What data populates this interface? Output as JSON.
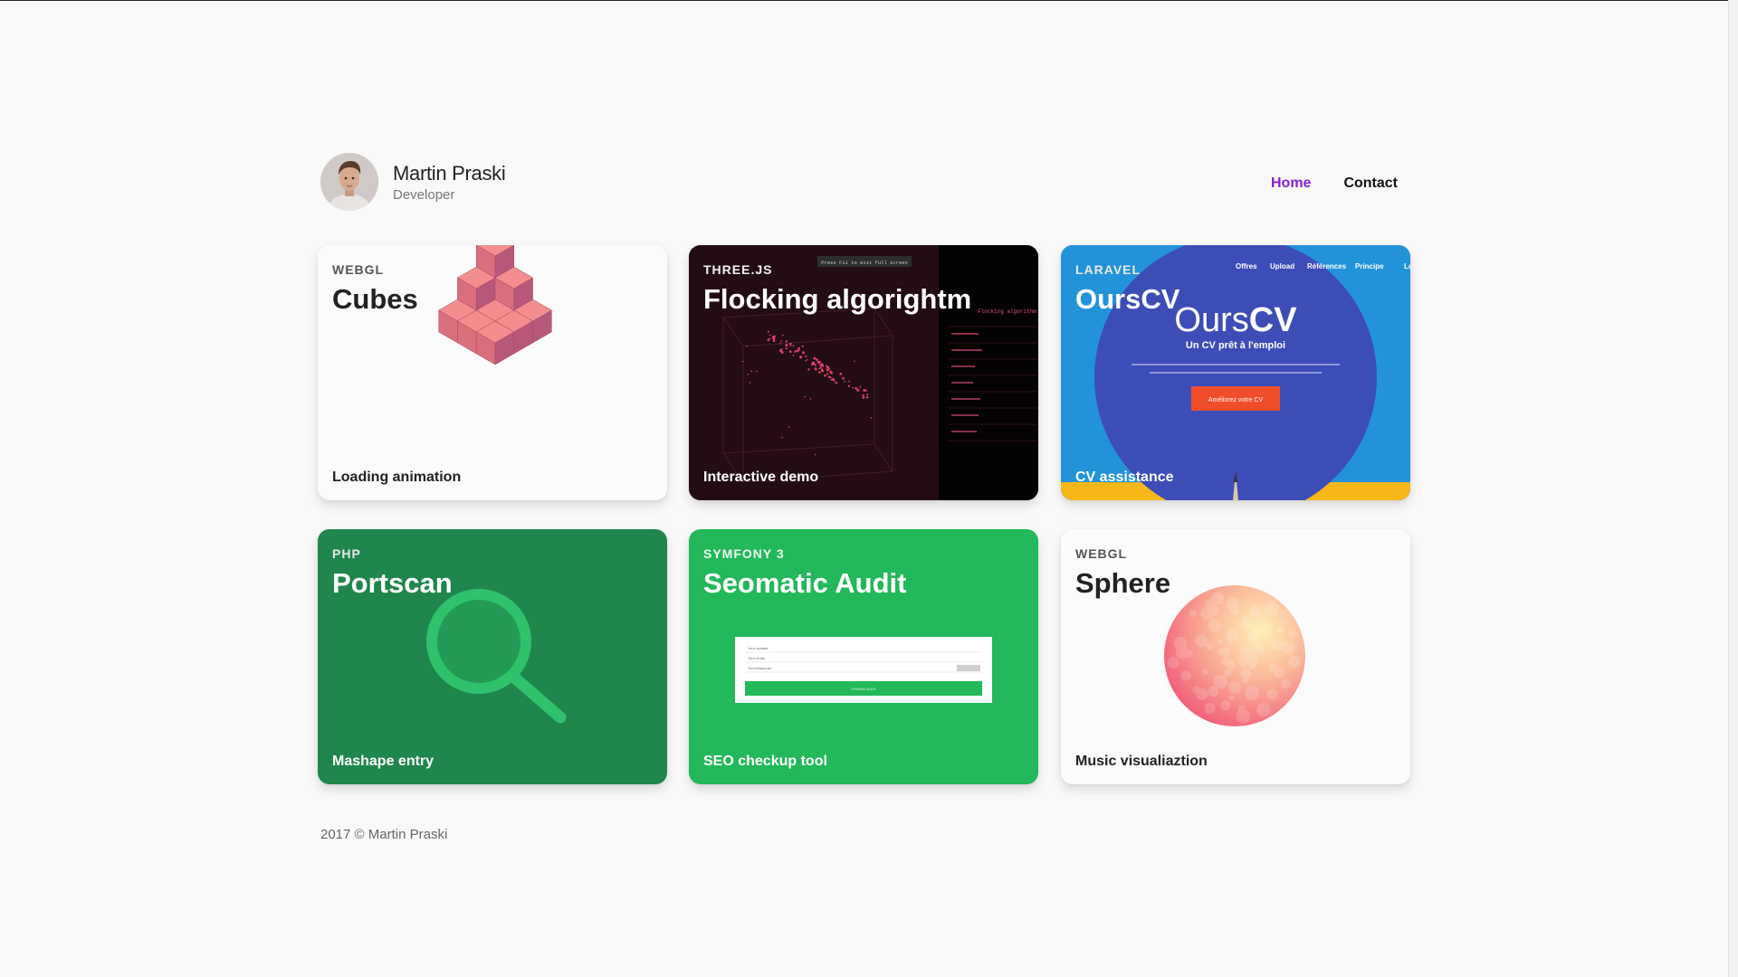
{
  "brand": {
    "name": "Martin Praski",
    "role": "Developer"
  },
  "nav": [
    {
      "label": "Home",
      "active": true
    },
    {
      "label": "Contact",
      "active": false
    }
  ],
  "projects": [
    {
      "tag": "WEBGL",
      "title": "Cubes",
      "description": "Loading animation",
      "icon": "cubes-3d-icon"
    },
    {
      "tag": "THREE.JS",
      "title": "Flocking algorightm",
      "description": "Interactive demo",
      "icon": "flocking-preview"
    },
    {
      "tag": "LARAVEL",
      "title": "OursCV",
      "description": "CV assistance",
      "icon": "ourscv-preview"
    },
    {
      "tag": "PHP",
      "title": "Portscan",
      "description": "Mashape entry",
      "icon": "magnifier-icon"
    },
    {
      "tag": "SYMFONY 3",
      "title": "Seomatic Audit",
      "description": "SEO checkup tool",
      "icon": "audit-form-preview"
    },
    {
      "tag": "WEBGL",
      "title": "Sphere",
      "description": "Music visualiaztion",
      "icon": "sphere-icon"
    }
  ],
  "previews": {
    "flocking": {
      "fullscreen_hint": "Press F11 to exit full screen",
      "panel_title": "Flocking algorithm"
    },
    "ourscv": {
      "nav": [
        "Offres",
        "Upload",
        "Références",
        "Principe",
        "Lo"
      ],
      "logo_light": "Ours",
      "logo_bold": "CV",
      "tagline": "Un CV prêt à l'emploi",
      "button": "Améliorez votre CV"
    },
    "seomatic": {
      "fields": [
        "Your domain",
        "Your email",
        "Your keywords"
      ],
      "button": "SYNOMAI AUDIT"
    }
  },
  "footer": {
    "text": "2017 © Martin Praski"
  },
  "colors": {
    "accent": "#8a1ecf",
    "portscan": "#1f864d",
    "seomatic": "#23b85a",
    "flocking": "#230c16",
    "ourscv_outer": "#2393d9",
    "ourscv_inner": "#3d4db7",
    "cube": "#f58585"
  }
}
